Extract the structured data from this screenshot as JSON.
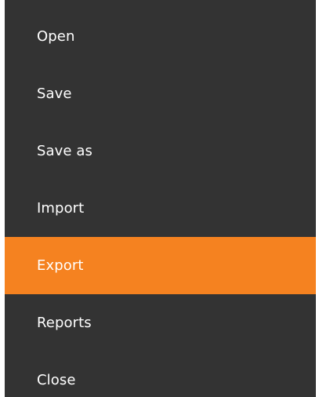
{
  "menu": {
    "background_color": "#333333",
    "accent_color": "#f58220",
    "text_color": "#ffffff",
    "items": [
      {
        "label": "Open",
        "active": false
      },
      {
        "label": "Save",
        "active": false
      },
      {
        "label": "Save as",
        "active": false
      },
      {
        "label": "Import",
        "active": false
      },
      {
        "label": "Export",
        "active": true
      },
      {
        "label": "Reports",
        "active": false
      },
      {
        "label": "Close",
        "active": false
      }
    ]
  }
}
